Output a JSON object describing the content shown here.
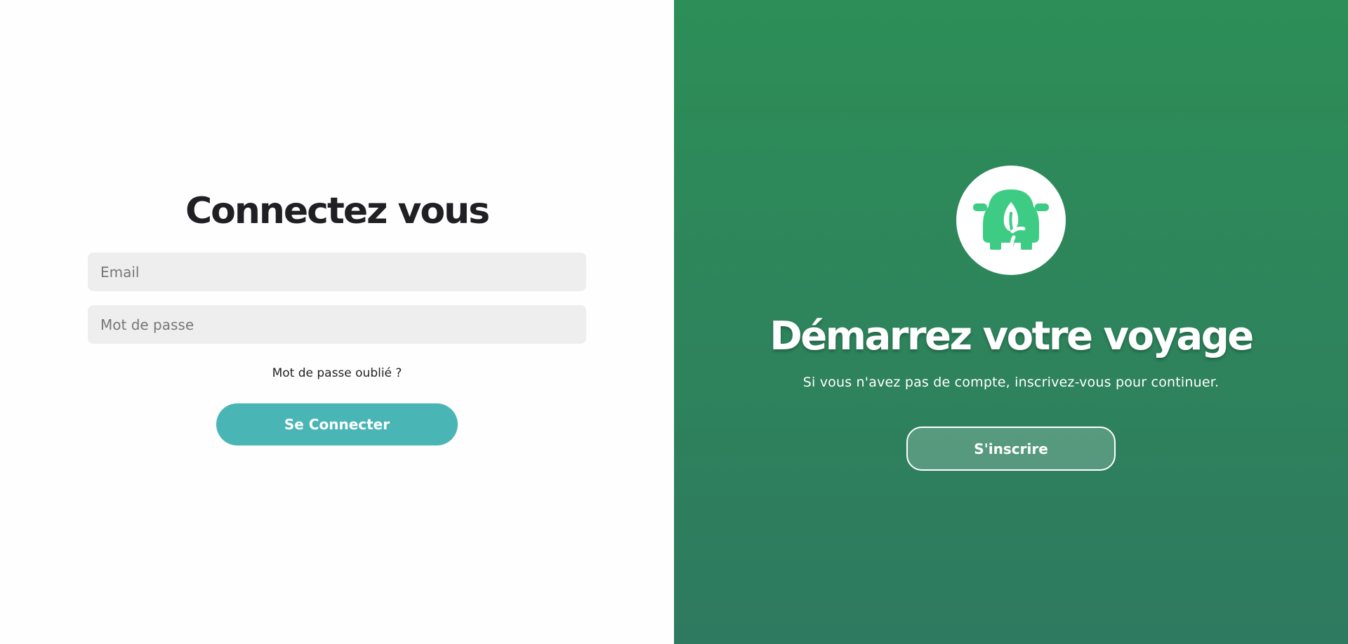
{
  "login": {
    "title": "Connectez vous",
    "email_placeholder": "Email",
    "password_placeholder": "Mot de passe",
    "forgot_password": "Mot de passe oublié ?",
    "submit_label": "Se Connecter"
  },
  "signup": {
    "logo_icon": "eco-car-leaf-icon",
    "title": "Démarrez votre voyage",
    "subtitle": "Si vous n'avez pas de compte, inscrivez-vous pour continuer.",
    "button_label": "S'inscrire"
  },
  "colors": {
    "accent_teal": "#4ab5b5",
    "panel_green_top": "#2d8e57",
    "panel_green_bottom": "#2e7a60",
    "logo_green": "#3ecc85",
    "input_bg": "#eeeeee"
  }
}
